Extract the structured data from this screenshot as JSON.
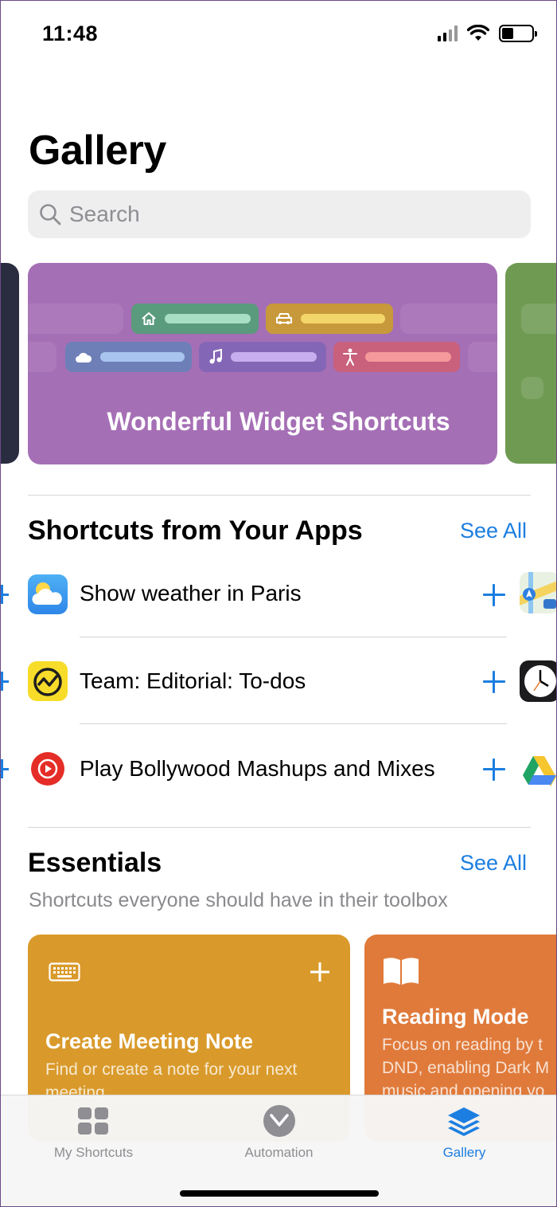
{
  "status_bar": {
    "time": "11:48",
    "battery_level": 0.4
  },
  "page": {
    "title": "Gallery"
  },
  "search": {
    "placeholder": "Search"
  },
  "hero": {
    "title": "Wonderful Widget Shortcuts",
    "background": "#a56fb5",
    "pills": [
      {
        "icon": "home-icon",
        "color": "#5a9a7d",
        "bar": "#a8dfc4"
      },
      {
        "icon": "car-icon",
        "color": "#c8993a",
        "bar": "#f3d66a"
      },
      {
        "icon": "cloud-icon",
        "color": "#6e7fb8",
        "bar": "#a9c4ef"
      },
      {
        "icon": "music-note-icon",
        "color": "#8466b6",
        "bar": "#c7aeee"
      },
      {
        "icon": "accessibility-icon",
        "color": "#c9607c",
        "bar": "#f59a9c"
      }
    ]
  },
  "apps_section": {
    "title": "Shortcuts from Your Apps",
    "see_all": "See All",
    "items": [
      {
        "label": "Show weather in Paris",
        "icon": "weather-app-icon"
      },
      {
        "label": "Team: Editorial: To-dos",
        "icon": "basecamp-app-icon"
      },
      {
        "label": "Play Bollywood Mashups and Mixes",
        "icon": "youtube-music-app-icon"
      }
    ],
    "peek_icons": [
      "maps-app-icon",
      "clock-app-icon",
      "google-drive-app-icon"
    ]
  },
  "essentials": {
    "title": "Essentials",
    "see_all": "See All",
    "subtitle": "Shortcuts everyone should have in their toolbox",
    "cards": [
      {
        "title": "Create Meeting Note",
        "desc_line1": "Find or create a note for your next",
        "desc_line2": "meeting",
        "icon": "keyboard-icon",
        "color": "#d99a2b"
      },
      {
        "title": "Reading Mode",
        "desc_line1": "Focus on reading by t",
        "desc_line2": "DND, enabling Dark M",
        "desc_line3": "music and opening yo",
        "icon": "book-icon",
        "color": "#e07a3a"
      }
    ]
  },
  "tabbar": {
    "tabs": [
      {
        "label": "My Shortcuts",
        "icon": "grid-icon",
        "active": false
      },
      {
        "label": "Automation",
        "icon": "clock-check-icon",
        "active": false
      },
      {
        "label": "Gallery",
        "icon": "layers-icon",
        "active": true
      }
    ],
    "accent": "#1c7ee0"
  }
}
